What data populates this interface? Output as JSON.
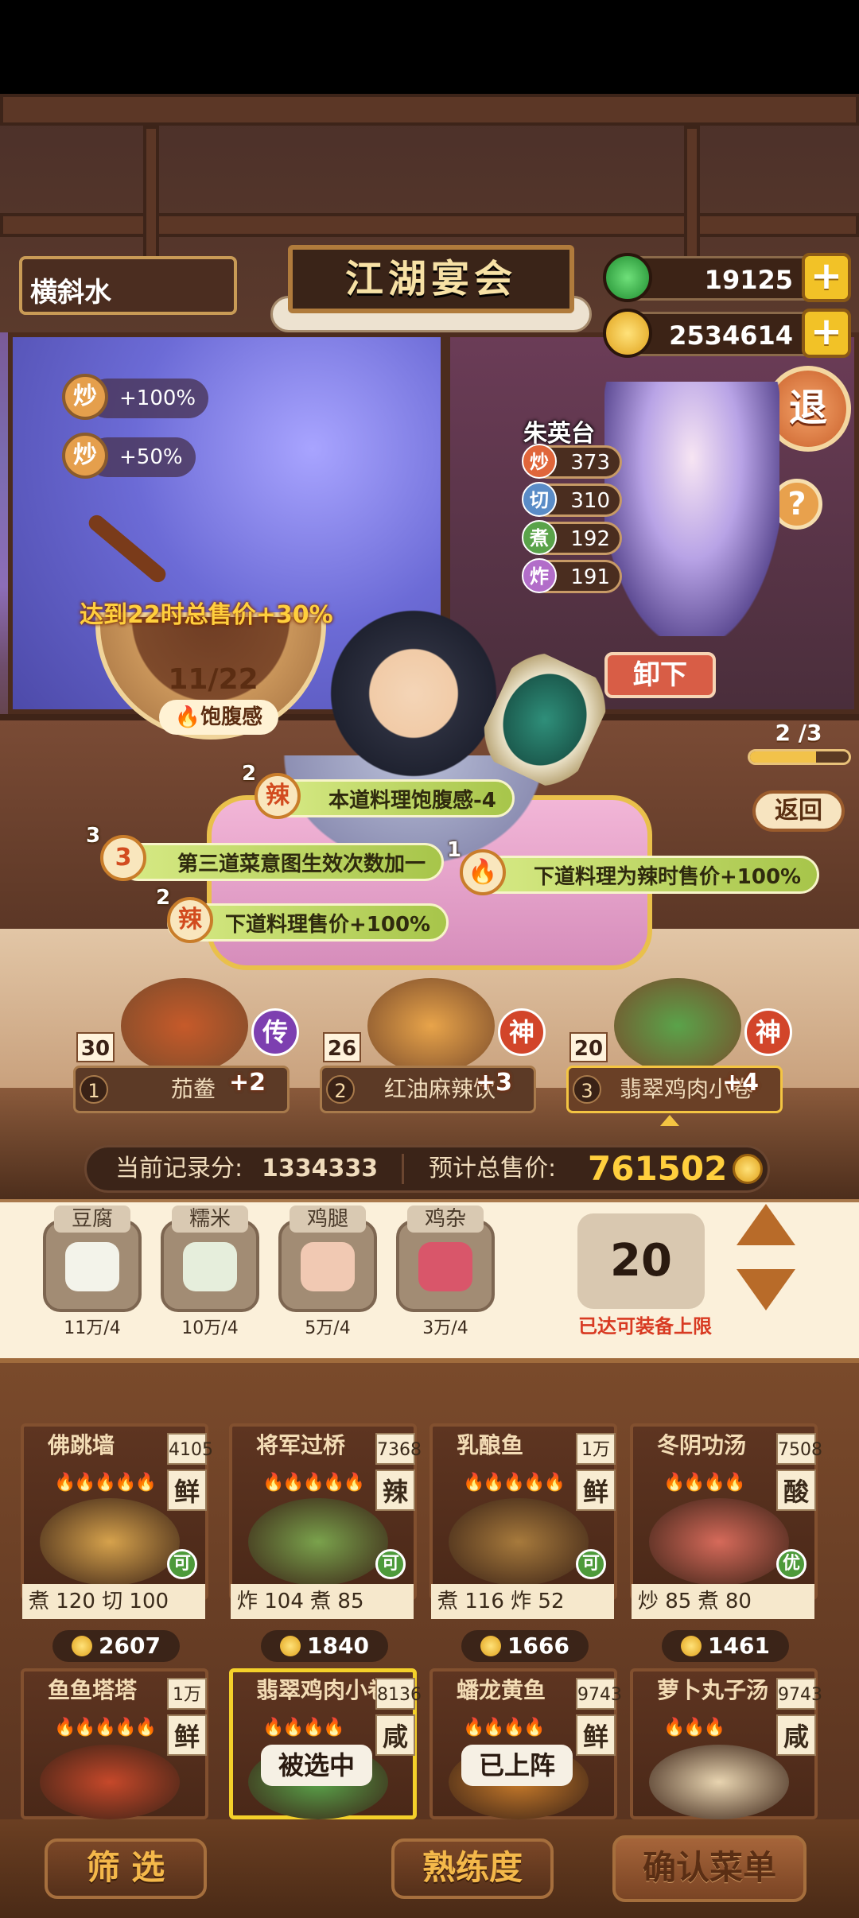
{
  "header": {
    "player_name": "横斜水",
    "sign_title": "江湖宴会",
    "jade_amount": "19125",
    "coin_amount": "2534614",
    "exit_label": "退",
    "help_label": "?"
  },
  "buffs": [
    {
      "icon": "炒",
      "text": "+100%"
    },
    {
      "icon": "炒",
      "text": "+50%"
    }
  ],
  "chef": {
    "name": "朱英台",
    "stats": [
      {
        "icon": "炒",
        "value": "373",
        "color": "#e0663b"
      },
      {
        "icon": "切",
        "value": "310",
        "color": "#5a8cc7"
      },
      {
        "icon": "煮",
        "value": "192",
        "color": "#5aa34a"
      },
      {
        "icon": "炸",
        "value": "191",
        "color": "#b26dc9"
      }
    ],
    "unload_label": "卸下"
  },
  "bowl": {
    "goal": "达到22时总售价+30%",
    "count": "11/22",
    "label": "饱腹感"
  },
  "progress": {
    "text": "2 /3",
    "fraction": 0.67,
    "back_label": "返回"
  },
  "effects": [
    {
      "num": "2",
      "icon": "辣",
      "text": "本道料理饱腹感-4"
    },
    {
      "num": "3",
      "icon": "3",
      "text": "第三道菜意图生效次数加一"
    },
    {
      "num": "1",
      "icon": "🔥",
      "text": "下道料理为辣时售价+100%"
    },
    {
      "num": "2",
      "icon": "辣",
      "text": "下道料理售价+100%"
    }
  ],
  "dishes": [
    {
      "idx": "1",
      "name": "茄鲞",
      "qty": "30",
      "bonus": "+2",
      "grade": "传",
      "grade_color": "#7d3fb0",
      "pic_color": "#c65a2a"
    },
    {
      "idx": "2",
      "name": "红油麻辣饮",
      "qty": "26",
      "bonus": "+3",
      "grade": "神",
      "grade_color": "#d2452a",
      "pic_color": "#e8a44a"
    },
    {
      "idx": "3",
      "name": "翡翠鸡肉小卷",
      "qty": "20",
      "bonus": "+4",
      "grade": "神",
      "grade_color": "#d2452a",
      "pic_color": "#5aa34a"
    }
  ],
  "score": {
    "record_label": "当前记录分:",
    "record_value": "1334333",
    "total_label": "预计总售价:",
    "total_value": "761502"
  },
  "ingredients": [
    {
      "name": "豆腐",
      "count": "11万/4",
      "color": "#f3f3ea"
    },
    {
      "name": "糯米",
      "count": "10万/4",
      "color": "#e6eedc"
    },
    {
      "name": "鸡腿",
      "count": "5万/4",
      "color": "#f1c9b3"
    },
    {
      "name": "鸡杂",
      "count": "3万/4",
      "color": "#d9566a"
    }
  ],
  "limit": {
    "value": "20",
    "text": "已达可装备上限"
  },
  "recipes_row1": [
    {
      "title": "佛跳墙",
      "price": "4105",
      "flavor": "鲜",
      "flames": "🔥🔥🔥🔥🔥",
      "badge": "可",
      "req": "煮 120  切 100",
      "cost": "2607",
      "color": "#d6a24c"
    },
    {
      "title": "将军过桥",
      "price": "7368",
      "flavor": "辣",
      "flames": "🔥🔥🔥🔥🔥",
      "badge": "可",
      "req": "炸 104  煮 85",
      "cost": "1840",
      "color": "#7aa24c"
    },
    {
      "title": "乳酿鱼",
      "price": "1万",
      "flavor": "鲜",
      "flames": "🔥🔥🔥🔥🔥",
      "badge": "可",
      "req": "煮 116  炸 52",
      "cost": "1666",
      "color": "#a77a3c"
    },
    {
      "title": "冬阴功汤",
      "price": "7508",
      "flavor": "酸",
      "flames": "🔥🔥🔥🔥",
      "badge": "优",
      "req": "炒 85   煮 80",
      "cost": "1461",
      "color": "#d66a5a"
    }
  ],
  "recipes_row2": [
    {
      "title": "鱼鱼塔塔",
      "price": "1万",
      "flavor": "鲜",
      "flames": "🔥🔥🔥🔥🔥",
      "state": "",
      "color": "#c6482a"
    },
    {
      "title": "翡翠鸡肉小卷",
      "price": "8136",
      "flavor": "咸",
      "flames": "🔥🔥🔥🔥",
      "state": "被选中",
      "color": "#5aa34a"
    },
    {
      "title": "蟠龙黄鱼",
      "price": "9743",
      "flavor": "鲜",
      "flames": "🔥🔥🔥🔥",
      "state": "已上阵",
      "color": "#c67a2a"
    },
    {
      "title": "萝卜丸子汤",
      "price": "9743",
      "flavor": "咸",
      "flames": "🔥🔥🔥",
      "state": "",
      "color": "#e8d4b0"
    }
  ],
  "bottom": {
    "filter": "筛 选",
    "proficiency": "熟练度",
    "confirm": "确认菜单"
  }
}
